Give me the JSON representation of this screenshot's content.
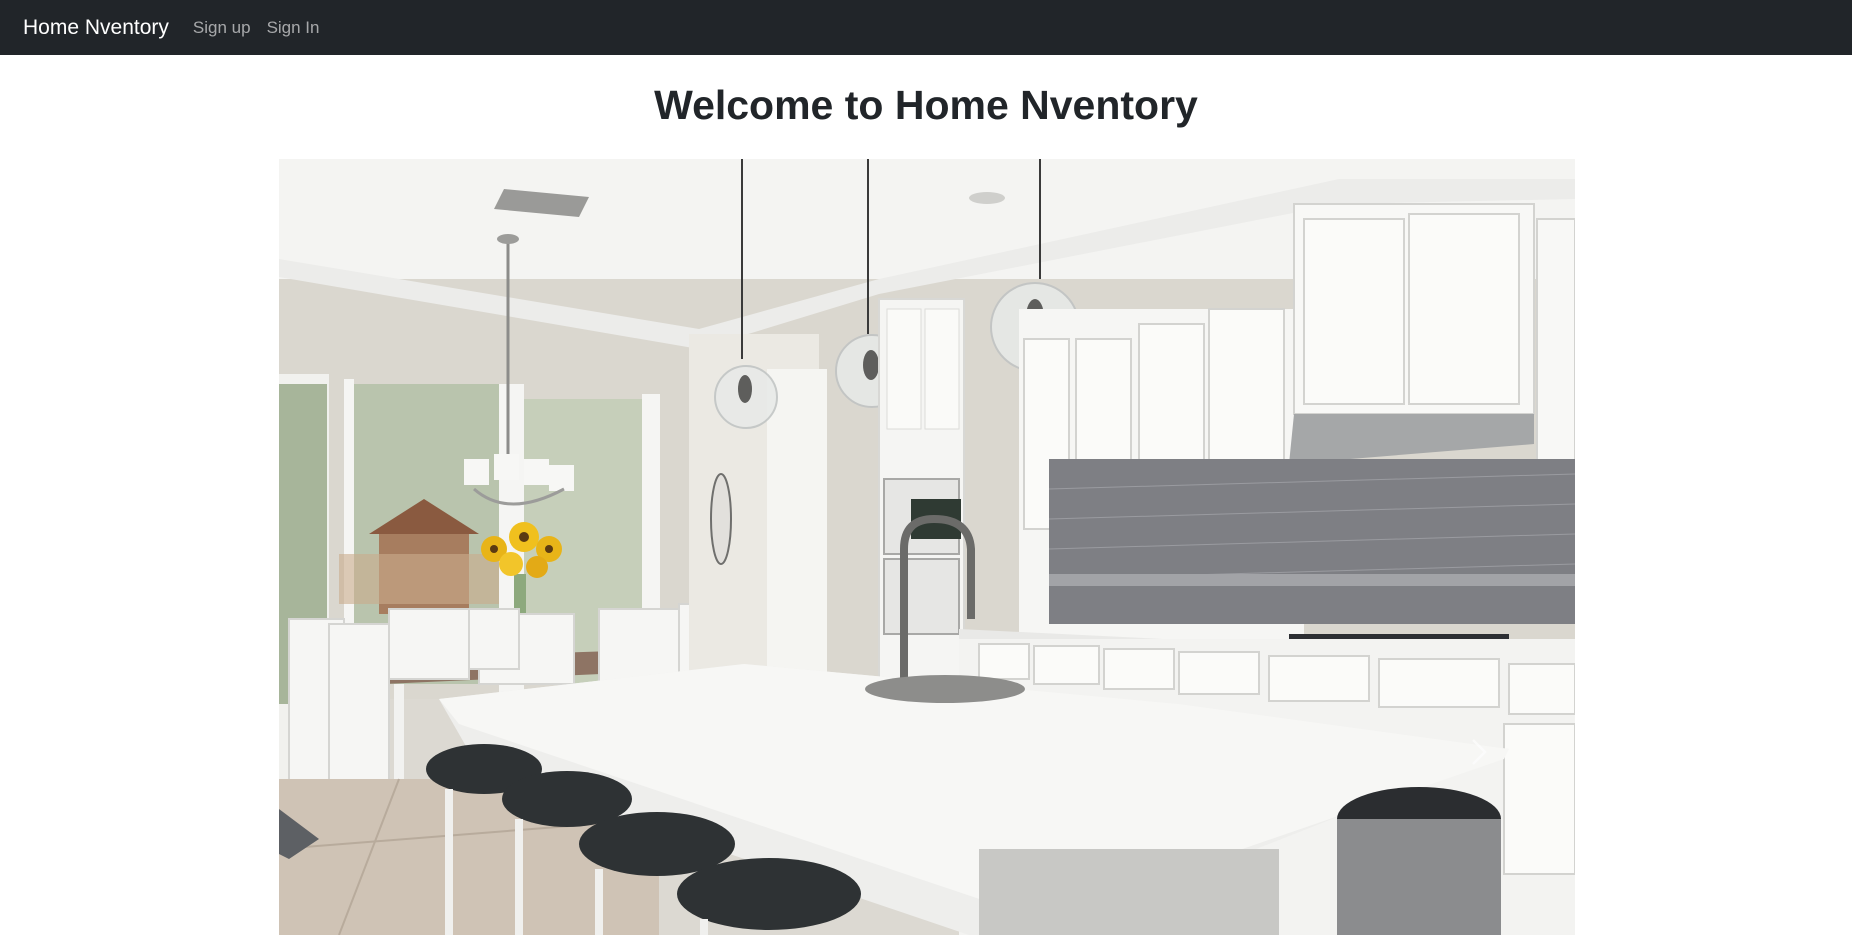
{
  "navbar": {
    "brand": "Home Nventory",
    "links": [
      {
        "label": "Sign up"
      },
      {
        "label": "Sign In"
      }
    ]
  },
  "main": {
    "heading": "Welcome to Home Nventory"
  },
  "carousel": {
    "slide_image": "kitchen-interior-photo",
    "next_icon": "chevron-right-icon"
  },
  "colors": {
    "navbar_bg": "#212529",
    "brand_text": "#ffffff",
    "nav_link_text": "rgba(255,255,255,0.6)",
    "heading_text": "#212529"
  }
}
